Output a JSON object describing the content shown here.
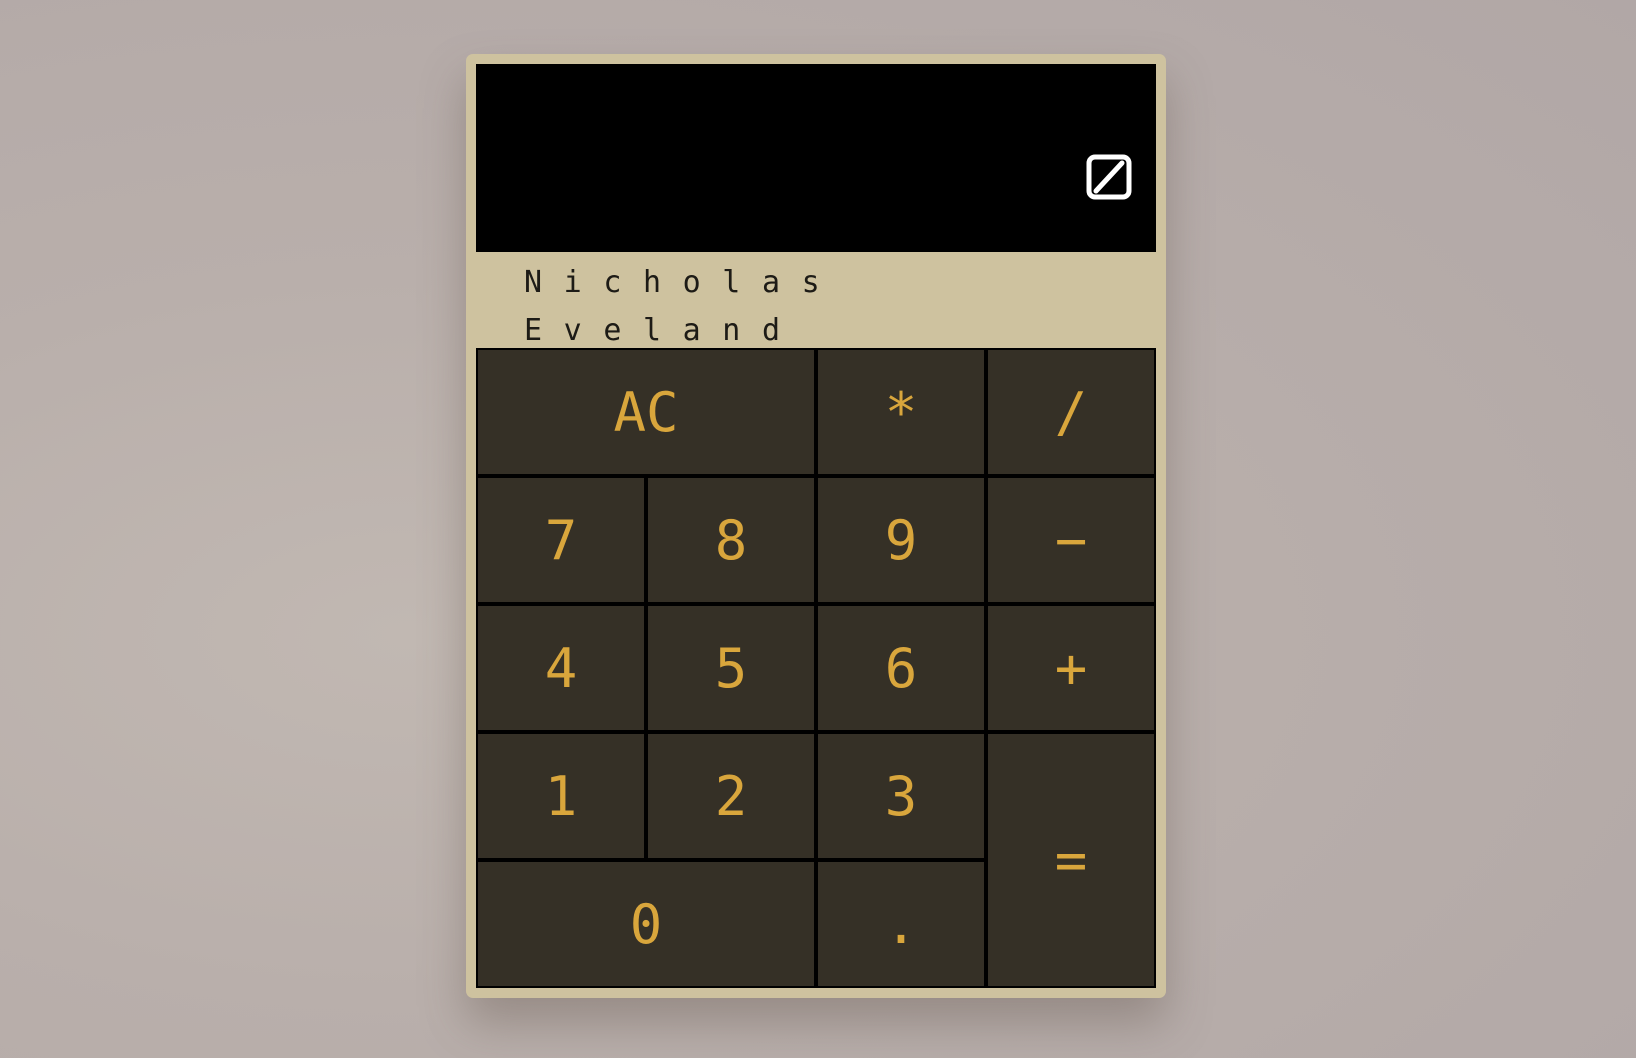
{
  "display": {
    "value": "",
    "toggle_icon": "slashed-square-icon"
  },
  "author": {
    "line1": "Nicholas",
    "line2": "Eveland"
  },
  "keys": [
    {
      "name": "clear-button",
      "label": "AC"
    },
    {
      "name": "multiply-button",
      "label": "*"
    },
    {
      "name": "divide-button",
      "label": "/"
    },
    {
      "name": "digit-7-button",
      "label": "7"
    },
    {
      "name": "digit-8-button",
      "label": "8"
    },
    {
      "name": "digit-9-button",
      "label": "9"
    },
    {
      "name": "subtract-button",
      "label": "−"
    },
    {
      "name": "digit-4-button",
      "label": "4"
    },
    {
      "name": "digit-5-button",
      "label": "5"
    },
    {
      "name": "digit-6-button",
      "label": "6"
    },
    {
      "name": "add-button",
      "label": "+"
    },
    {
      "name": "digit-1-button",
      "label": "1"
    },
    {
      "name": "digit-2-button",
      "label": "2"
    },
    {
      "name": "digit-3-button",
      "label": "3"
    },
    {
      "name": "equals-button",
      "label": "="
    },
    {
      "name": "digit-0-button",
      "label": "0"
    },
    {
      "name": "decimal-button",
      "label": "."
    }
  ],
  "colors": {
    "background": "#b9afab",
    "body": "#cec29f",
    "display": "#000000",
    "key": "#353026",
    "key_text": "#d9a63c",
    "author_text": "#1d1b16"
  }
}
